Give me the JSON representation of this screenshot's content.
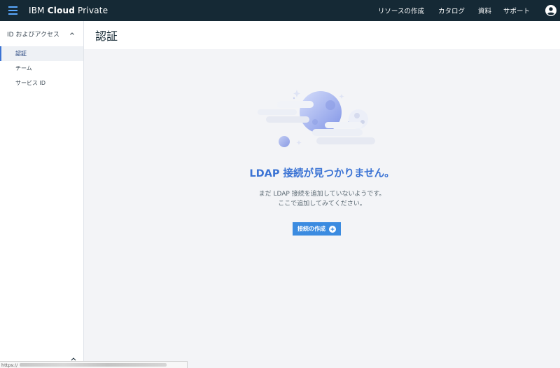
{
  "app": {
    "brand_prefix": "IBM ",
    "brand_bold": "Cloud",
    "brand_suffix": " Private"
  },
  "topnav": {
    "items": [
      {
        "label": "リソースの作成"
      },
      {
        "label": "カタログ"
      },
      {
        "label": "資料"
      },
      {
        "label": "サポート"
      }
    ]
  },
  "sidebar": {
    "group_label": "ID およびアクセス",
    "items": [
      {
        "label": "認証",
        "active": true
      },
      {
        "label": "チーム"
      },
      {
        "label": "サービス ID"
      }
    ]
  },
  "page": {
    "title": "認証"
  },
  "empty_state": {
    "title": "LDAP 接続が見つかりません。",
    "desc_line1": "まだ LDAP 接続を追加していないようです。",
    "desc_line2": "ここで追加してみてください。",
    "button_label": "接続の作成"
  },
  "statusbar": {
    "url_prefix": "https://"
  },
  "colors": {
    "topbar": "#152935",
    "accent": "#3b73d4",
    "button": "#3b8be0"
  }
}
